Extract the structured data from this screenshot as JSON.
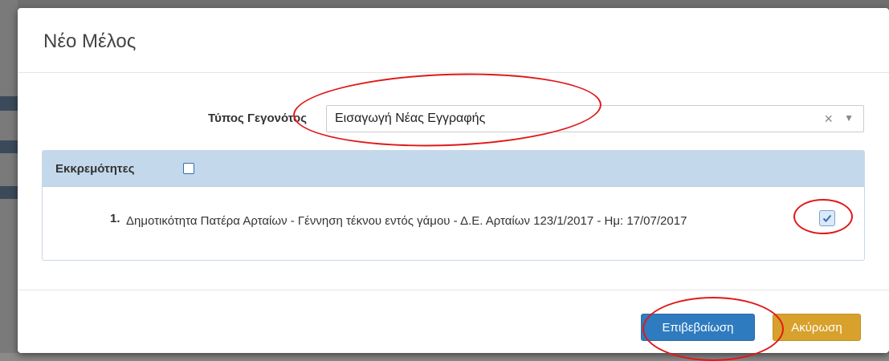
{
  "modal": {
    "title": "Νέο Μέλος"
  },
  "form": {
    "event_type_label": "Τύπος Γεγονότος",
    "event_type_value": "Εισαγωγή Νέας Εγγραφής",
    "clear_symbol": "×",
    "arrow_symbol": "▼"
  },
  "pending": {
    "heading": "Εκκρεμότητες",
    "heading_checked": false,
    "items": [
      {
        "number": "1.",
        "text": "Δημοτικότητα Πατέρα Αρταίων - Γέννηση τέκνου εντός γάμου - Δ.Ε. Αρταίων 123/1/2017 - Ημ: 17/07/2017",
        "checked": true
      }
    ]
  },
  "footer": {
    "confirm_label": "Επιβεβαίωση",
    "cancel_label": "Ακύρωση"
  },
  "colors": {
    "annotation": "#e01818",
    "confirm": "#2f7bbf",
    "cancel": "#d7a12c",
    "panel_heading": "#c3d8ea"
  }
}
